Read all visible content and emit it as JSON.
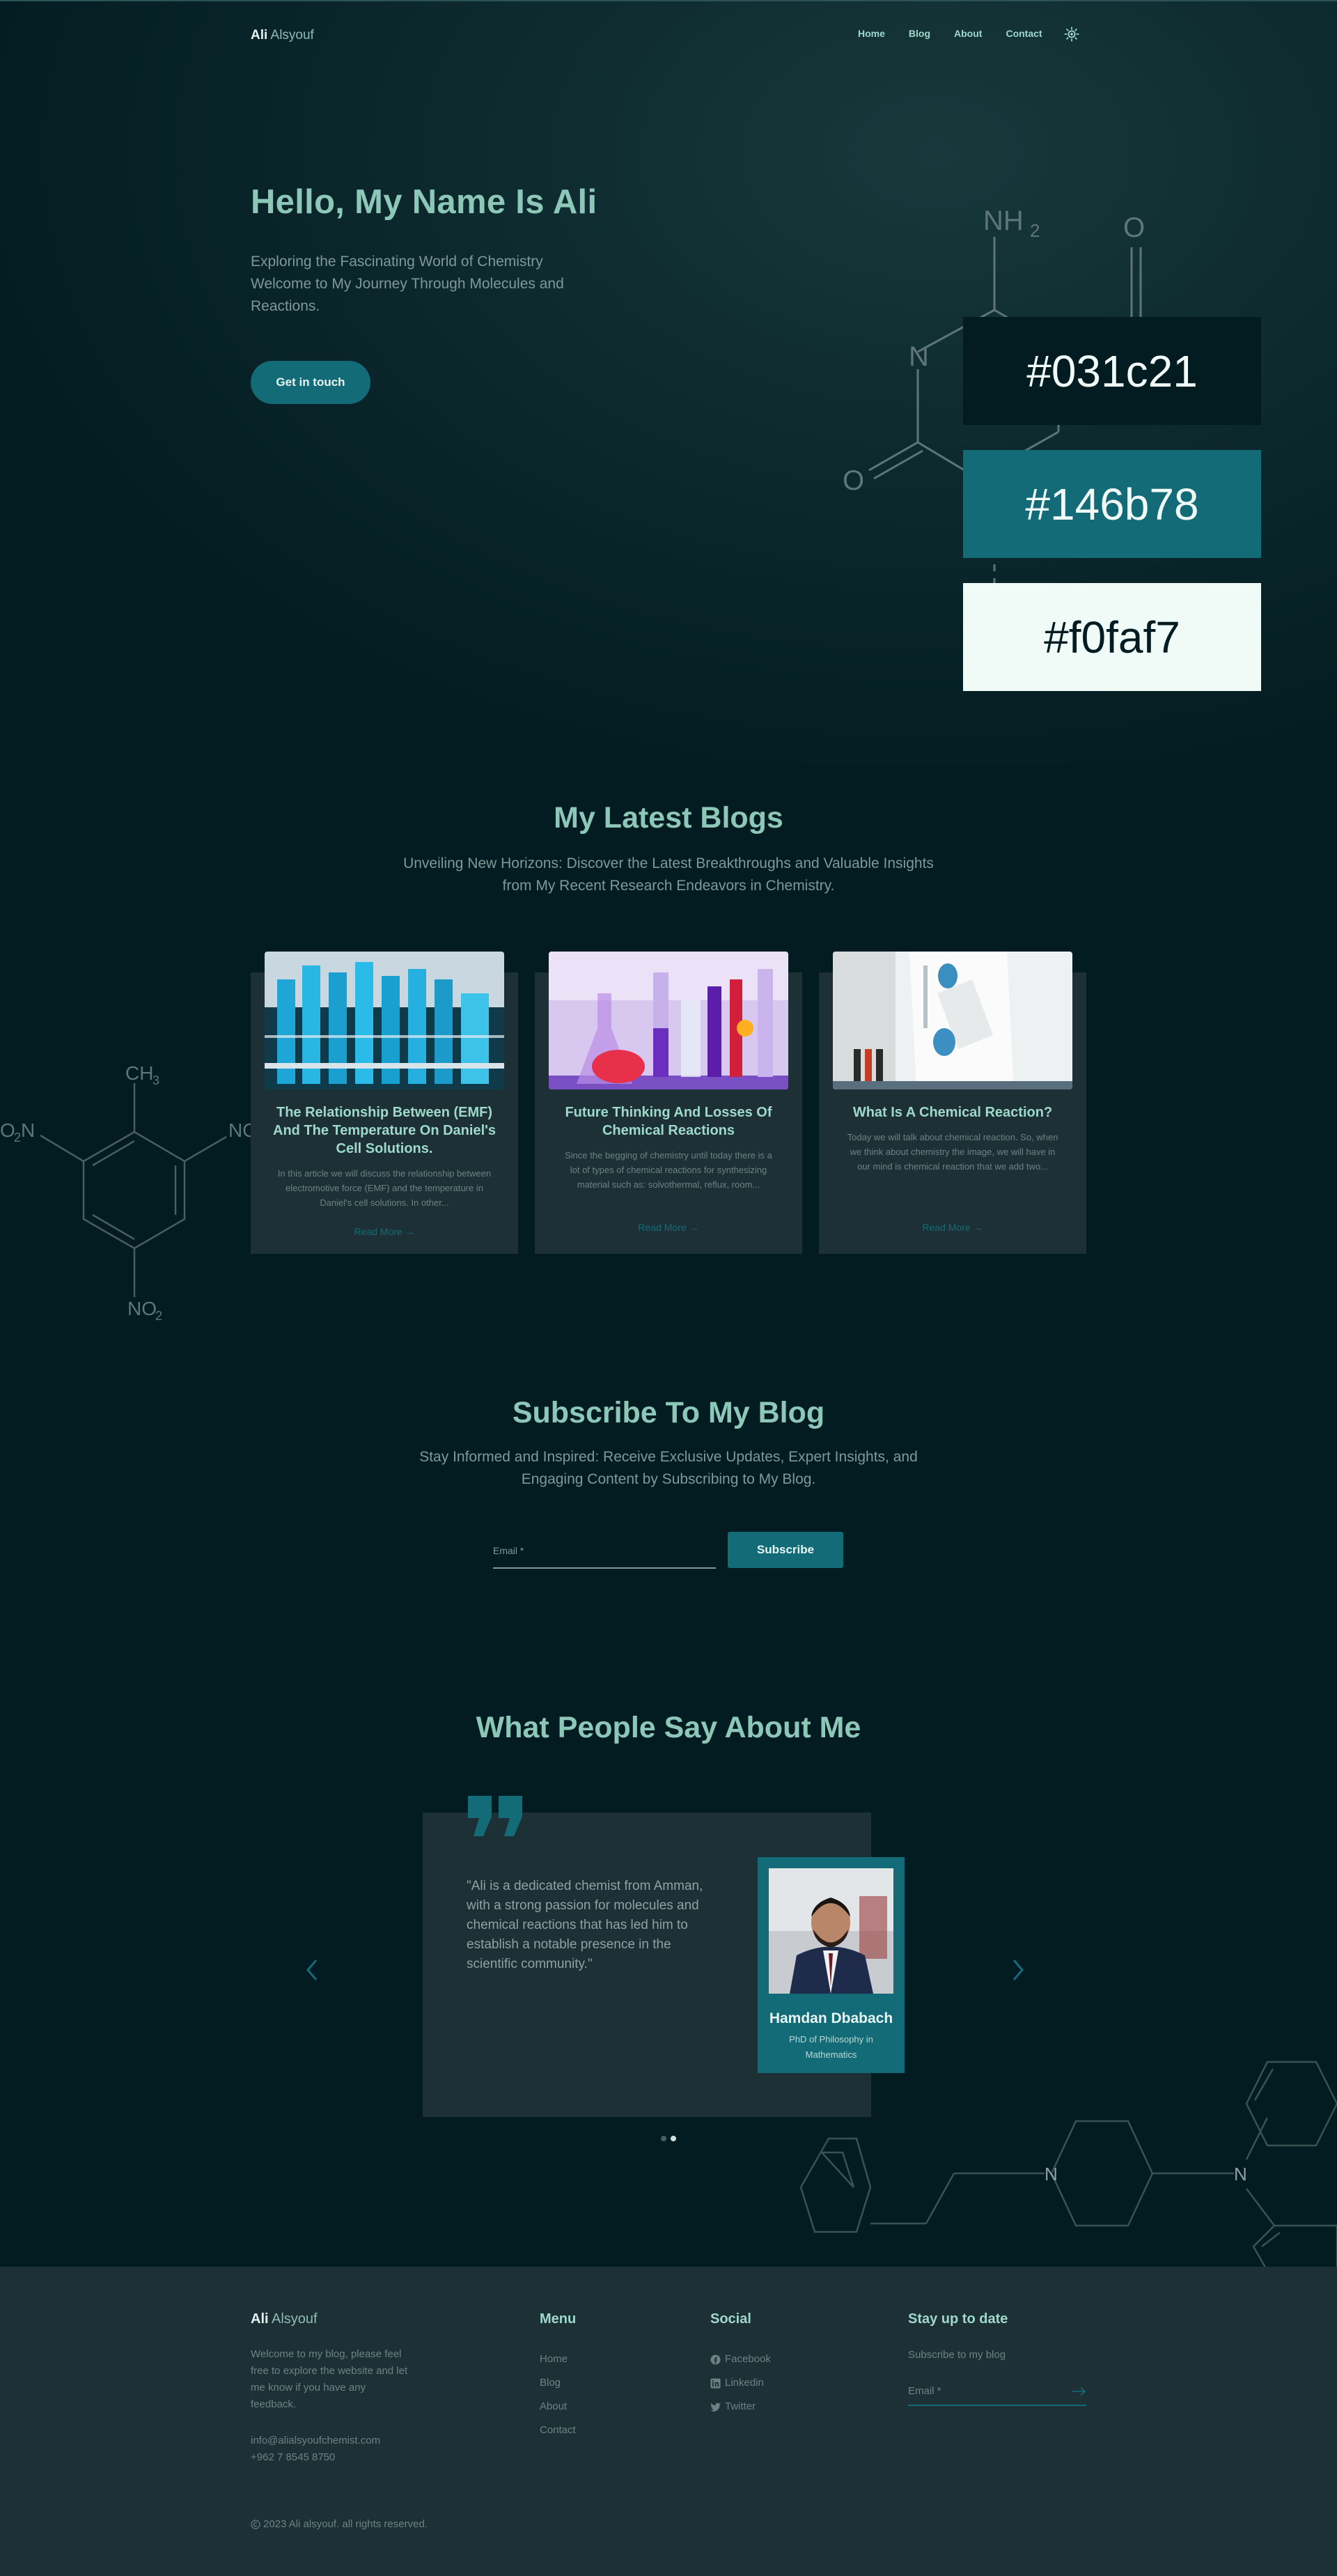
{
  "brand": {
    "first": "Ali",
    "last": "Alsyouf"
  },
  "nav": {
    "items": [
      "Home",
      "Blog",
      "About",
      "Contact"
    ]
  },
  "hero": {
    "title": "Hello, My Name Is Ali",
    "subtitle": "Exploring the Fascinating World of Chemistry Welcome to My Journey Through Molecules and Reactions.",
    "cta": "Get in touch",
    "molecule_labels": {
      "nh2": "NH",
      "nh2_sub": "2",
      "o_top": "O",
      "n": "N",
      "o_left": "O"
    }
  },
  "swatches": [
    "#031c21",
    "#146b78",
    "#f0faf7"
  ],
  "blogs": {
    "title": "My Latest Blogs",
    "subtitle": "Unveiling New Horizons: Discover the Latest Breakthroughs and Valuable Insights from My Recent Research Endeavors in Chemistry.",
    "cards": [
      {
        "title": "The Relationship Between (EMF) And The Temperature On Daniel's Cell Solutions.",
        "text": "In this article we will discuss the relationship between electromotive force (EMF) and the temperature in Daniel's cell solutions. In other...",
        "link": "Read More →"
      },
      {
        "title": "Future Thinking And Losses Of Chemical Reactions",
        "text": "Since the begging of chemistry until today there is a lot of types of chemical reactions for synthesizing material such as: solvothermal, reflux, room...",
        "link": "Read More →"
      },
      {
        "title": "What Is A Chemical Reaction?",
        "text": "Today we will talk about chemical reaction. So, when we think about chemistry the image, we will have in our mind is chemical reaction that we add two...",
        "link": "Read More →"
      }
    ],
    "molecule_labels": {
      "ch3": "CH",
      "ch3_sub": "3",
      "no2": "NO",
      "no2_sub": "2",
      "o2n": "O",
      "o2n_sub": "2",
      "o2n_n": "N",
      "nc": "NO"
    }
  },
  "subscribe": {
    "title": "Subscribe To My Blog",
    "subtitle": "Stay Informed and Inspired: Receive Exclusive Updates, Expert Insights, and Engaging Content by Subscribing to My Blog.",
    "email_placeholder": "Email *",
    "button": "Subscribe"
  },
  "testimonials": {
    "title": "What People Say About Me",
    "quote": "\"Ali is a dedicated chemist from Amman, with a strong passion for molecules and chemical reactions that has led him to establish a notable presence in the scientific community.\"",
    "name": "Hamdan Dbabach",
    "role": "PhD of Philosophy in Mathematics",
    "molecule_labels": {
      "n1": "N",
      "n2": "N"
    }
  },
  "footer": {
    "brand_first": "Ali",
    "brand_last": "Alsyouf",
    "description": "Welcome to my blog, please feel free to explore the website and let me know if you have any feedback.",
    "email": "info@alialsyoufchemist.com",
    "phone": "+962 7 8545 8750",
    "menu_title": "Menu",
    "menu": [
      "Home",
      "Blog",
      "About",
      "Contact"
    ],
    "social_title": "Social",
    "social": [
      {
        "icon": "facebook-icon",
        "label": "Facebook"
      },
      {
        "icon": "linkedin-icon",
        "label": "Linkedin"
      },
      {
        "icon": "twitter-icon",
        "label": "Twitter"
      }
    ],
    "stay_title": "Stay up to date",
    "stay_text": "Subscribe to my blog",
    "email_placeholder": "Email *",
    "copyright": "2023 Ali alsyouf. all rights reserved."
  },
  "colors": {
    "accent": "#146b78",
    "background": "#031c21",
    "light": "#f0faf7",
    "heading": "#8dc7b8"
  }
}
